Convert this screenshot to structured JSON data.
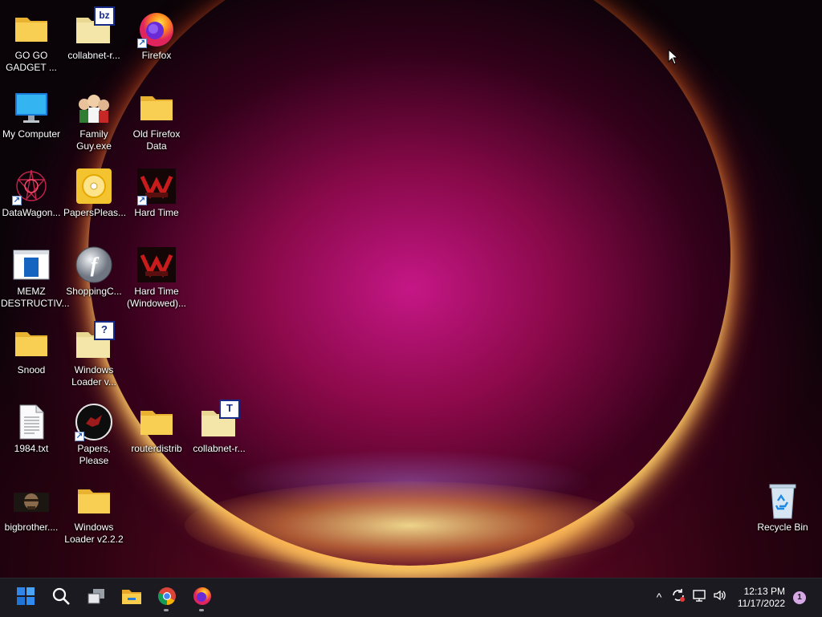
{
  "desktop": {
    "icons": [
      {
        "label": "GO GO GADGET ...",
        "icon": "folder-icon"
      },
      {
        "label": "collabnet-r...",
        "icon": "archive-bz-icon"
      },
      {
        "label": "Firefox",
        "icon": "firefox-icon"
      },
      {
        "label": "My Computer",
        "icon": "monitor-icon"
      },
      {
        "label": "Family Guy.exe",
        "icon": "family-guy-icon"
      },
      {
        "label": "Old Firefox Data",
        "icon": "folder-icon"
      },
      {
        "label": "DataWagon...",
        "icon": "datawagon-icon"
      },
      {
        "label": "PapersPleas...",
        "icon": "disc-icon"
      },
      {
        "label": "Hard Time",
        "icon": "hard-time-icon"
      },
      {
        "label": "MEMZ DESTRUCTIV...",
        "icon": "window-icon"
      },
      {
        "label": "ShoppingC...",
        "icon": "flash-icon"
      },
      {
        "label": "Hard Time (Windowed)...",
        "icon": "hard-time-icon"
      },
      {
        "label": "Snood",
        "icon": "folder-icon"
      },
      {
        "label": "Windows Loader v...",
        "icon": "archive-help-icon"
      },
      {
        "label": "1984.txt",
        "icon": "text-file-icon"
      },
      {
        "label": "Papers, Please",
        "icon": "papers-please-icon"
      },
      {
        "label": "routerdistrib",
        "icon": "folder-icon"
      },
      {
        "label": "collabnet-r...",
        "icon": "archive-t-icon"
      },
      {
        "label": "bigbrother....",
        "icon": "photo-icon"
      },
      {
        "label": "Windows Loader v2.2.2",
        "icon": "folder-icon"
      },
      {
        "label": "Recycle Bin",
        "icon": "recycle-bin-icon"
      }
    ],
    "badges": {
      "bz": "bz",
      "help": "?",
      "t": "T",
      "flash": "f",
      "shortcut": "↗"
    }
  },
  "taskbar": {
    "start": "start-icon",
    "search": "search-icon",
    "taskview": "task-view-icon",
    "explorer": "file-explorer-icon",
    "chrome": "chrome-icon",
    "firefox": "firefox-icon",
    "tray": {
      "chevron": "^",
      "time": "12:13 PM",
      "date": "11/17/2022",
      "notifications": "1"
    }
  },
  "colors": {
    "taskbar_bg": "#1c1a21",
    "folder_yellow": "#f6c945",
    "accent_blue": "#2f86e8"
  }
}
